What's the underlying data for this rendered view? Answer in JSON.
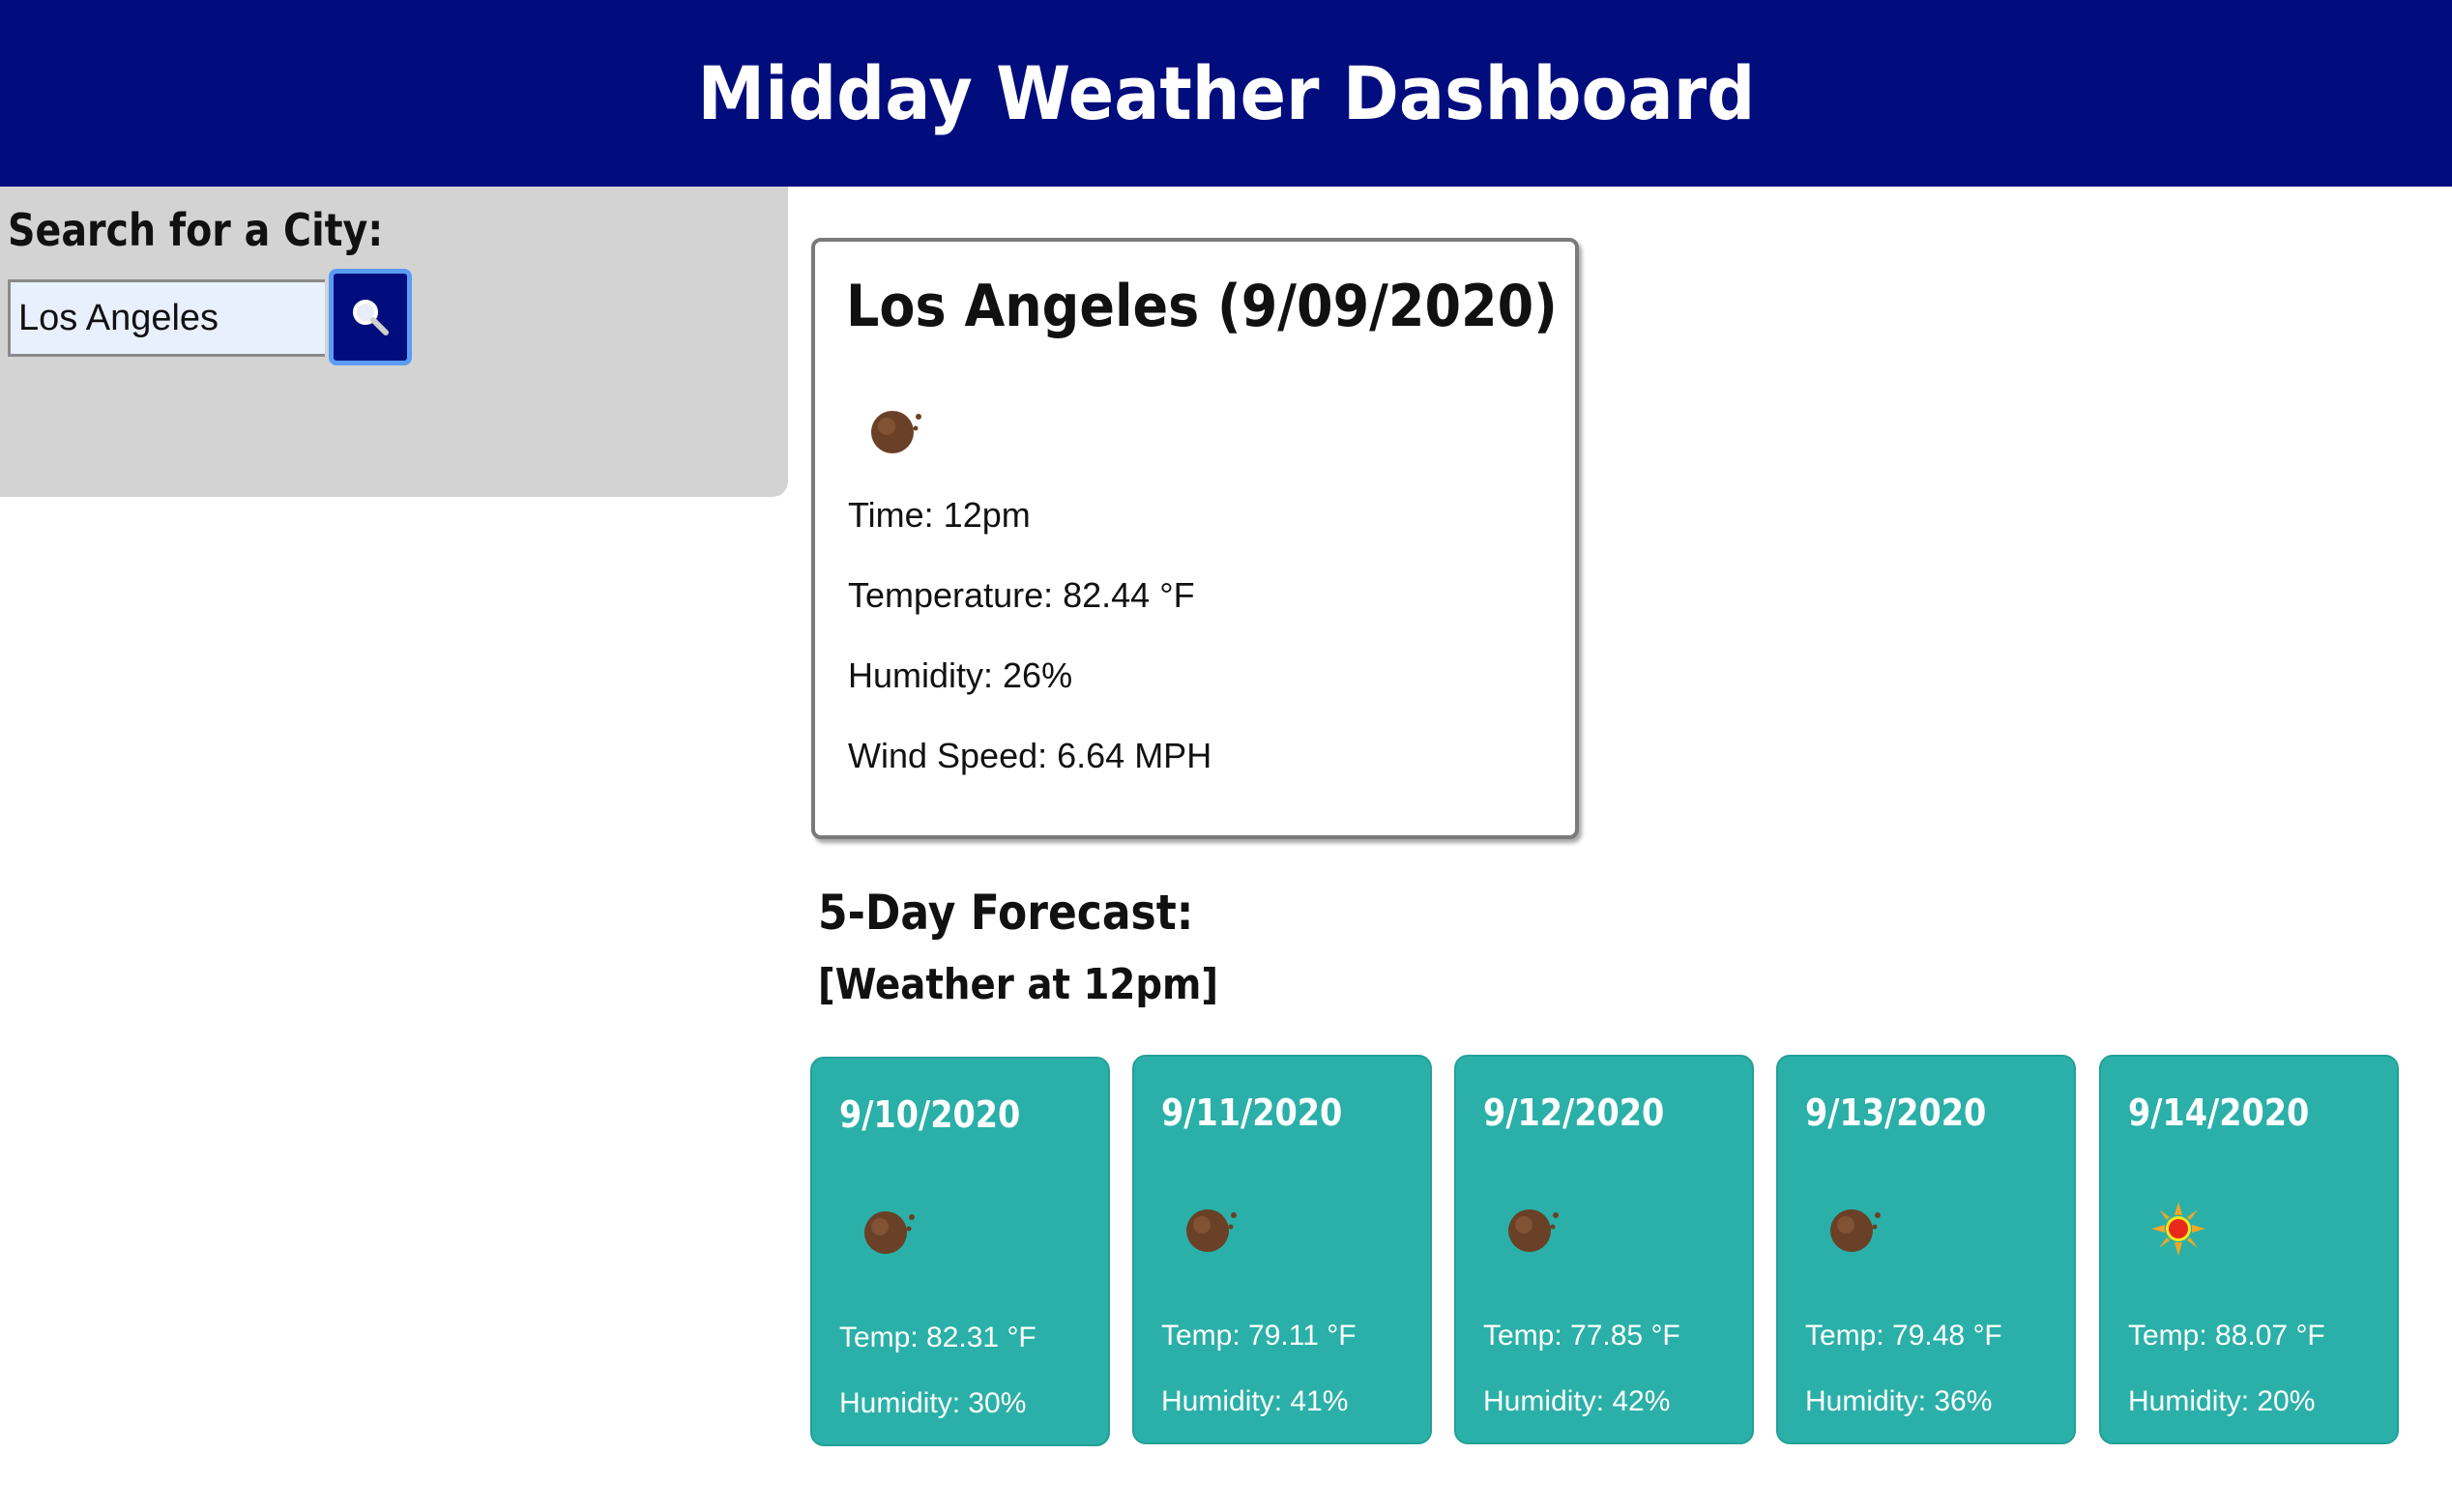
{
  "header": {
    "title": "Midday Weather Dashboard"
  },
  "sidebar": {
    "title": "Search for a City:",
    "search_value": "Los Angeles",
    "search_button_icon": "magnifier-icon"
  },
  "current": {
    "title": "Los Angeles (9/09/2020)",
    "icon": "overcast-clouds-icon",
    "time": "Time: 12pm",
    "temperature": "Temperature: 82.44 °F",
    "humidity": "Humidity: 26%",
    "wind": "Wind Speed: 6.64 MPH"
  },
  "forecast": {
    "heading": "5-Day Forecast:",
    "subheading": "[Weather at 12pm]",
    "days": [
      {
        "date": "9/10/2020",
        "icon": "overcast-clouds-icon",
        "temp": "Temp: 82.31 °F",
        "humidity": "Humidity: 30%"
      },
      {
        "date": "9/11/2020",
        "icon": "overcast-clouds-icon",
        "temp": "Temp: 79.11 °F",
        "humidity": "Humidity: 41%"
      },
      {
        "date": "9/12/2020",
        "icon": "overcast-clouds-icon",
        "temp": "Temp: 77.85 °F",
        "humidity": "Humidity: 42%"
      },
      {
        "date": "9/13/2020",
        "icon": "overcast-clouds-icon",
        "temp": "Temp: 79.48 °F",
        "humidity": "Humidity: 36%"
      },
      {
        "date": "9/14/2020",
        "icon": "clear-sun-icon",
        "temp": "Temp: 88.07 °F",
        "humidity": "Humidity: 20%"
      }
    ]
  },
  "colors": {
    "header_bg": "#020d7d",
    "sidebar_bg": "#d3d3d3",
    "card_teal": "#2ab0a8",
    "button_border": "#5b9cf5"
  }
}
